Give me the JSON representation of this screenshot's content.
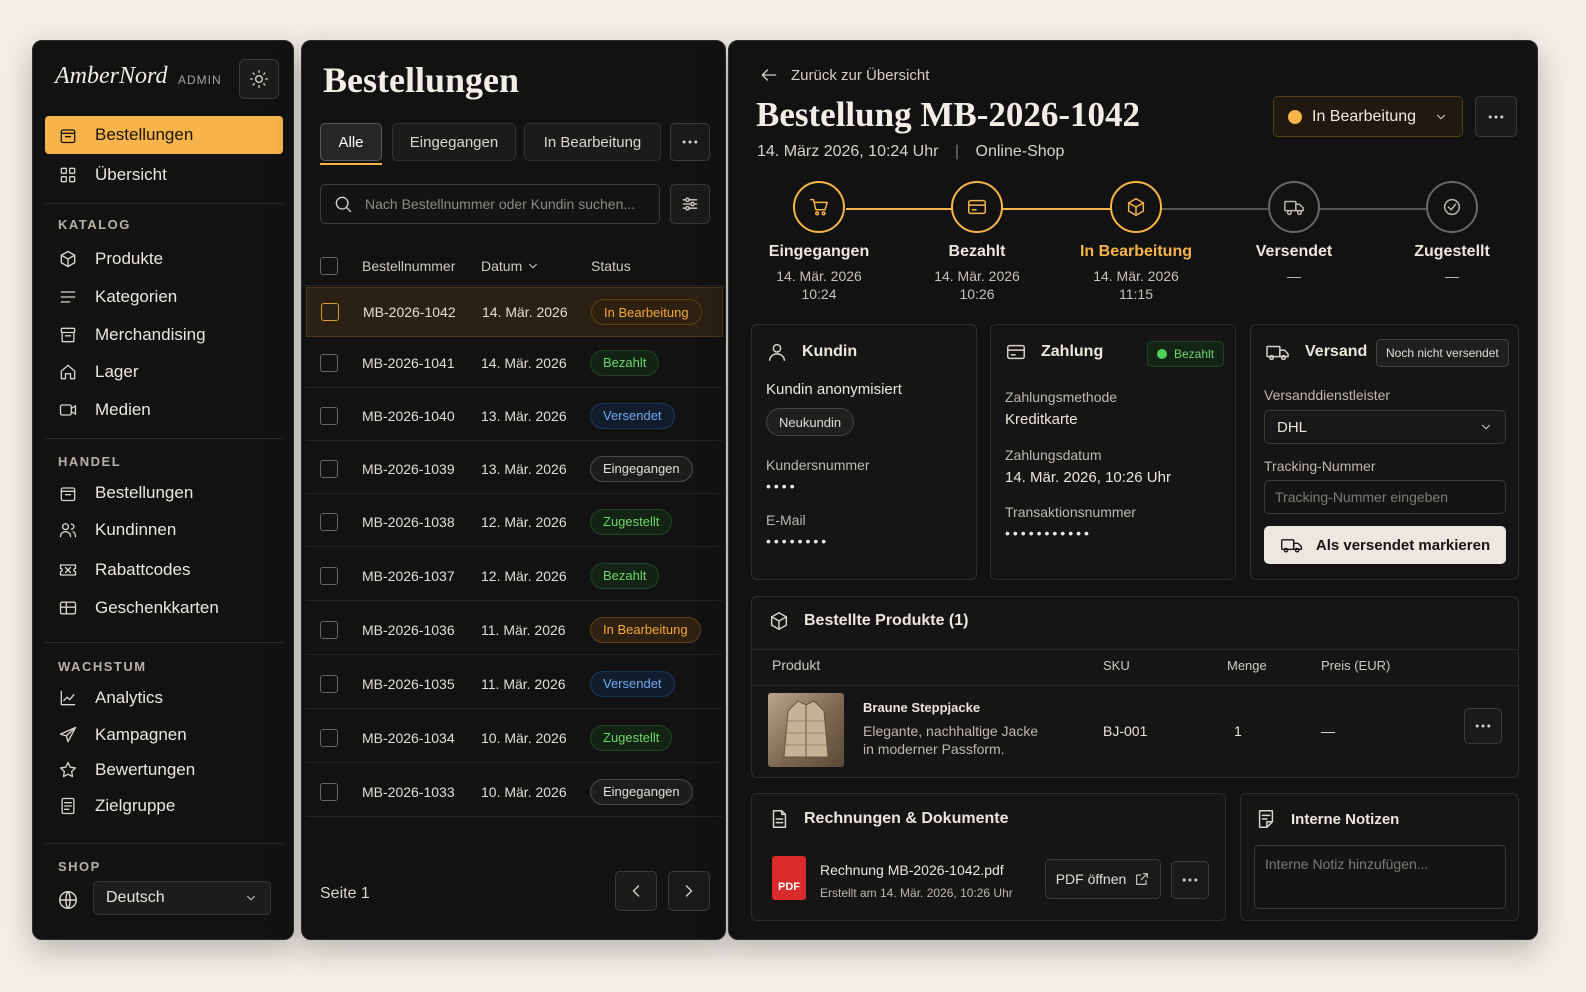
{
  "brand": {
    "name": "AmberNord",
    "tag": "ADMIN"
  },
  "sidebar": {
    "top": [
      {
        "label": "Bestellungen",
        "icon": "bag-icon",
        "active": true
      },
      {
        "label": "Übersicht",
        "icon": "grid-icon"
      }
    ],
    "sections": [
      {
        "title": "KATALOG",
        "items": [
          "Produkte",
          "Kategorien",
          "Merchandising",
          "Lager",
          "Medien"
        ]
      },
      {
        "title": "HANDEL",
        "items": [
          "Bestellungen",
          "Kundinnen",
          "Rabattcodes",
          "Geschenkkarten"
        ]
      },
      {
        "title": "WACHSTUM",
        "items": [
          "Analytics",
          "Kampagnen",
          "Bewertungen",
          "Zielgruppe"
        ]
      },
      {
        "title": "SHOP",
        "items": []
      }
    ],
    "language": "Deutsch"
  },
  "orders": {
    "title": "Bestellungen",
    "tabs": [
      "Alle",
      "Eingegangen",
      "In Bearbeitung"
    ],
    "search_placeholder": "Nach Bestellnummer oder Kundin suchen...",
    "columns": [
      "Bestellnummer",
      "Datum",
      "Status"
    ],
    "rows": [
      {
        "id": "MB-2026-1042",
        "date": "14. Mär. 2026",
        "status": "In Bearbeitung",
        "kind": "proc"
      },
      {
        "id": "MB-2026-1041",
        "date": "14. Mär. 2026",
        "status": "Bezahlt",
        "kind": "paid"
      },
      {
        "id": "MB-2026-1040",
        "date": "13. Mär. 2026",
        "status": "Versendet",
        "kind": "ship"
      },
      {
        "id": "MB-2026-1039",
        "date": "13. Mär. 2026",
        "status": "Eingegangen",
        "kind": "new"
      },
      {
        "id": "MB-2026-1038",
        "date": "12. Mär. 2026",
        "status": "Zugestellt",
        "kind": "deliv"
      },
      {
        "id": "MB-2026-1037",
        "date": "12. Mär. 2026",
        "status": "Bezahlt",
        "kind": "paid"
      },
      {
        "id": "MB-2026-1036",
        "date": "11. Mär. 2026",
        "status": "In Bearbeitung",
        "kind": "proc"
      },
      {
        "id": "MB-2026-1035",
        "date": "11. Mär. 2026",
        "status": "Versendet",
        "kind": "ship"
      },
      {
        "id": "MB-2026-1034",
        "date": "10. Mär. 2026",
        "status": "Zugestellt",
        "kind": "deliv"
      },
      {
        "id": "MB-2026-1033",
        "date": "10. Mär. 2026",
        "status": "Eingegangen",
        "kind": "new"
      }
    ],
    "page": "Seite 1"
  },
  "detail": {
    "back": "Zurück zur Übersicht",
    "title": "Bestellung MB-2026-1042",
    "date": "14. März 2026, 10:24 Uhr",
    "channel": "Online-Shop",
    "status": "In Bearbeitung",
    "steps": [
      {
        "label": "Eingegangen",
        "date": "14. Mär. 2026",
        "time": "10:24",
        "state": "done"
      },
      {
        "label": "Bezahlt",
        "date": "14. Mär. 2026",
        "time": "10:26",
        "state": "done"
      },
      {
        "label": "In Bearbeitung",
        "date": "14. Mär. 2026",
        "time": "11:15",
        "state": "current"
      },
      {
        "label": "Versendet",
        "date": "—",
        "time": "",
        "state": "todo"
      },
      {
        "label": "Zugestellt",
        "date": "—",
        "time": "",
        "state": "todo"
      }
    ],
    "customer": {
      "title": "Kundin",
      "name": "Kundin anonymisiert",
      "tag": "Neukundin",
      "number_label": "Kundersnummer",
      "number": "••••",
      "email_label": "E-Mail",
      "email": "••••••••"
    },
    "payment": {
      "title": "Zahlung",
      "badge": "Bezahlt",
      "method_label": "Zahlungsmethode",
      "method": "Kreditkarte",
      "date_label": "Zahlungsdatum",
      "date": "14. Mär. 2026, 10:26 Uhr",
      "tx_label": "Transaktionsnummer",
      "tx": "•••••••••••"
    },
    "shipping": {
      "title": "Versand",
      "badge": "Noch nicht versendet",
      "carrier_label": "Versanddienstleister",
      "carrier": "DHL",
      "tracking_label": "Tracking-Nummer",
      "tracking_placeholder": "Tracking-Nummer eingeben",
      "button": "Als versendet markieren"
    },
    "products": {
      "title": "Bestellte Produkte (1)",
      "columns": [
        "Produkt",
        "SKU",
        "Menge",
        "Preis (EUR)"
      ],
      "items": [
        {
          "name": "Braune Steppjacke",
          "desc1": "Elegante, nachhaltige Jacke",
          "desc2": "in moderner Passform.",
          "sku": "BJ-001",
          "qty": "1",
          "price": "—"
        }
      ]
    },
    "documents": {
      "title": "Rechnungen & Dokumente",
      "file": "Rechnung MB-2026-1042.pdf",
      "created": "Erstellt am 14. Mär. 2026, 10:26 Uhr",
      "pdf_tag": "PDF",
      "open": "PDF öffnen"
    },
    "notes": {
      "title": "Interne Notizen",
      "placeholder": "Interne Notiz hinzufügen..."
    }
  },
  "colors": {
    "accent": "#f6b44a",
    "bg": "#121212",
    "page": "#f3eee7"
  }
}
